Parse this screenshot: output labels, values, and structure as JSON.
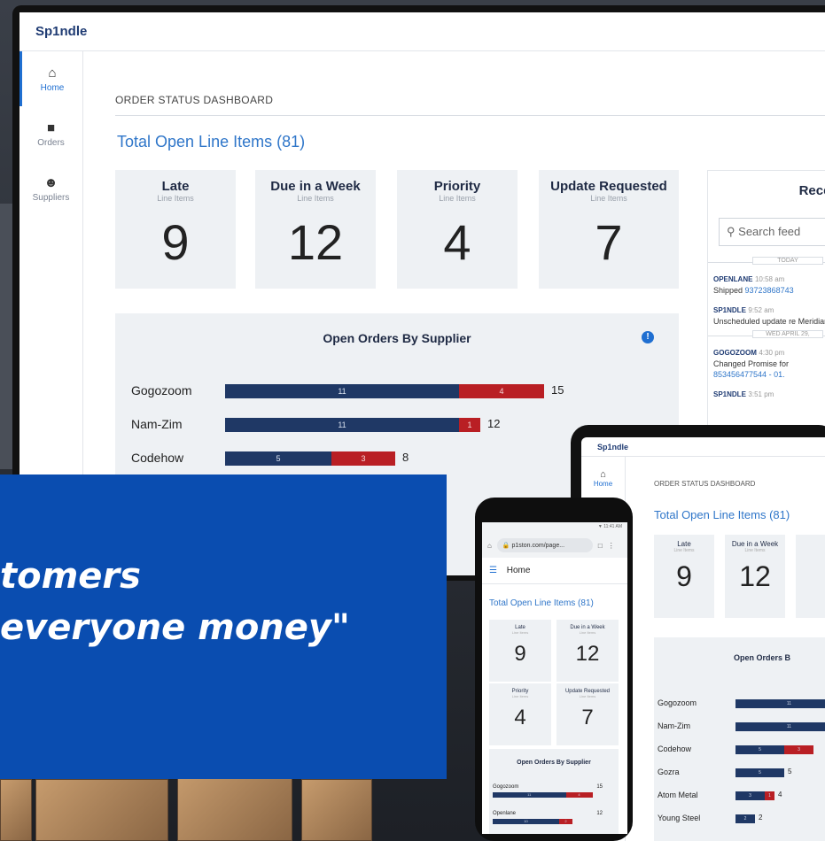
{
  "app": {
    "name": "Sp1ndle"
  },
  "sidebar": {
    "items": [
      {
        "label": "Home",
        "icon": "home-icon"
      },
      {
        "label": "Orders",
        "icon": "folder-icon"
      },
      {
        "label": "Suppliers",
        "icon": "people-icon"
      }
    ]
  },
  "dashboard": {
    "breadcrumb": "ORDER STATUS DASHBOARD",
    "total_title": "Total Open Line Items (81)",
    "cards": [
      {
        "title": "Late",
        "subtitle": "Line Items",
        "value": "9"
      },
      {
        "title": "Due in a Week",
        "subtitle": "Line Items",
        "value": "12"
      },
      {
        "title": "Priority",
        "subtitle": "Line Items",
        "value": "4"
      },
      {
        "title": "Update Requested",
        "subtitle": "Line Items",
        "value": "7"
      }
    ]
  },
  "chart_data": {
    "type": "bar",
    "title": "Open Orders By Supplier",
    "orientation": "horizontal",
    "stacked": true,
    "categories": [
      "Gogozoom",
      "Nam-Zim",
      "Codehow",
      "Gozra",
      "Atom Metal",
      "Young Steel"
    ],
    "series": [
      {
        "values": [
          11,
          11,
          5,
          5,
          3,
          2
        ]
      },
      {
        "values": [
          4,
          1,
          3,
          0,
          1,
          0
        ]
      }
    ],
    "totals": [
      15,
      12,
      8,
      5,
      4,
      2
    ],
    "colors": [
      "#1f3865",
      "#b91f24"
    ]
  },
  "recent": {
    "title": "Recent Ac",
    "search_placeholder": "Search feed",
    "divider_today": "TODAY",
    "divider_date": "WED APRIL 29,",
    "feed": [
      {
        "who": "OPENLANE",
        "time": "10:58 am",
        "text": "Shipped ",
        "link": "93723868743"
      },
      {
        "who": "SP1NDLE",
        "time": "9:52 am",
        "text": "Unscheduled update re Meridian for All Open L",
        "link": ""
      },
      {
        "who": "GOGOZOOM",
        "time": "4:30 pm",
        "text": "Changed Promise for",
        "link": "853456477544 - 01."
      },
      {
        "who": "SP1NDLE",
        "time": "3:51 pm",
        "text": "",
        "link": ""
      }
    ]
  },
  "tablet": {
    "app": "Sp1ndle",
    "nav_home": "Home",
    "breadcrumb": "ORDER STATUS DASHBOARD",
    "total_title": "Total Open Line Items (81)",
    "cards": [
      {
        "title": "Late",
        "subtitle": "Line Items",
        "value": "9"
      },
      {
        "title": "Due in a Week",
        "subtitle": "Line Items",
        "value": "12"
      }
    ],
    "chart_title": "Open Orders B",
    "rows": [
      {
        "label": "Gogozoom",
        "a": 11,
        "b": 0,
        "total": ""
      },
      {
        "label": "Nam-Zim",
        "a": 11,
        "b": 0,
        "total": ""
      },
      {
        "label": "Codehow",
        "a": 5,
        "b": 3,
        "total": ""
      },
      {
        "label": "Gozra",
        "a": 5,
        "b": 0,
        "total": "5"
      },
      {
        "label": "Atom Metal",
        "a": 3,
        "b": 1,
        "total": "4"
      },
      {
        "label": "Young Steel",
        "a": 2,
        "b": 0,
        "total": "2"
      }
    ]
  },
  "phone": {
    "status": "▼ 11:41 AM",
    "url": "p1ston.com/page...",
    "home_label": "Home",
    "total_title": "Total Open Line Items (81)",
    "cards": [
      {
        "title": "Late",
        "subtitle": "Line Items",
        "value": "9"
      },
      {
        "title": "Due in a Week",
        "subtitle": "Line Items",
        "value": "12"
      },
      {
        "title": "Priority",
        "subtitle": "Line Items",
        "value": "4"
      },
      {
        "title": "Update Requested",
        "subtitle": "Line Items",
        "value": "7"
      }
    ],
    "chart_title": "Open Orders By Supplier",
    "rows": [
      {
        "label": "Gogozoom",
        "a": 11,
        "b": 4,
        "total": "15"
      },
      {
        "label": "Openlane",
        "a": 10,
        "b": 2,
        "total": "12"
      }
    ]
  },
  "quote": {
    "line1": "tomers",
    "line2": "everyone money\""
  }
}
